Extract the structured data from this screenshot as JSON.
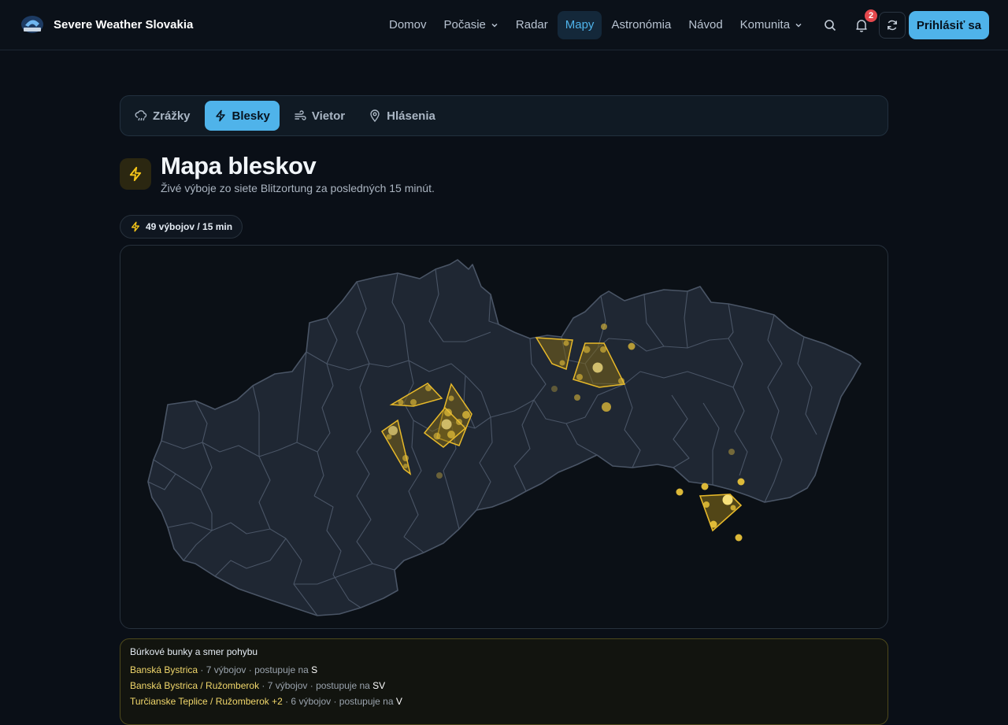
{
  "brand": {
    "name": "Severe Weather Slovakia"
  },
  "nav": {
    "items": [
      {
        "label": "Domov",
        "dropdown": false,
        "active": false
      },
      {
        "label": "Počasie",
        "dropdown": true,
        "active": false
      },
      {
        "label": "Radar",
        "dropdown": false,
        "active": false
      },
      {
        "label": "Mapy",
        "dropdown": false,
        "active": true
      },
      {
        "label": "Astronómia",
        "dropdown": false,
        "active": false
      },
      {
        "label": "Návod",
        "dropdown": false,
        "active": false
      },
      {
        "label": "Komunita",
        "dropdown": true,
        "active": false
      }
    ],
    "notification_count": "2",
    "login_label": "Prihlásiť sa"
  },
  "tabs": [
    {
      "label": "Zrážky",
      "icon": "rain-cloud-icon",
      "active": false
    },
    {
      "label": "Blesky",
      "icon": "lightning-icon",
      "active": true
    },
    {
      "label": "Vietor",
      "icon": "wind-icon",
      "active": false
    },
    {
      "label": "Hlásenia",
      "icon": "map-pin-icon",
      "active": false
    }
  ],
  "header": {
    "title": "Mapa bleskov",
    "subtitle": "Živé výboje zo siete Blitzortung za posledných 15 minút.",
    "strike_count_label": "49 výbojov / 15 min"
  },
  "colors": {
    "accent": "#4fb3ea",
    "lightning": "#f5c518",
    "badge": "#e5484d",
    "region_fill": "#1f2733",
    "region_stroke": "#4a5566"
  },
  "cells": {
    "title": "Búrkové bunky a smer pohybu",
    "items": [
      {
        "name": "Banská Bystrica",
        "detail": " · 7 výbojov · postupuje na ",
        "direction": "S"
      },
      {
        "name": "Banská Bystrica / Ružomberok",
        "detail": " · 7 výbojov · postupuje na ",
        "direction": "SV"
      },
      {
        "name": "Turčianske Teplice / Ružomberok +2",
        "detail": " · 6 výbojov · postupuje na ",
        "direction": "V"
      }
    ]
  }
}
